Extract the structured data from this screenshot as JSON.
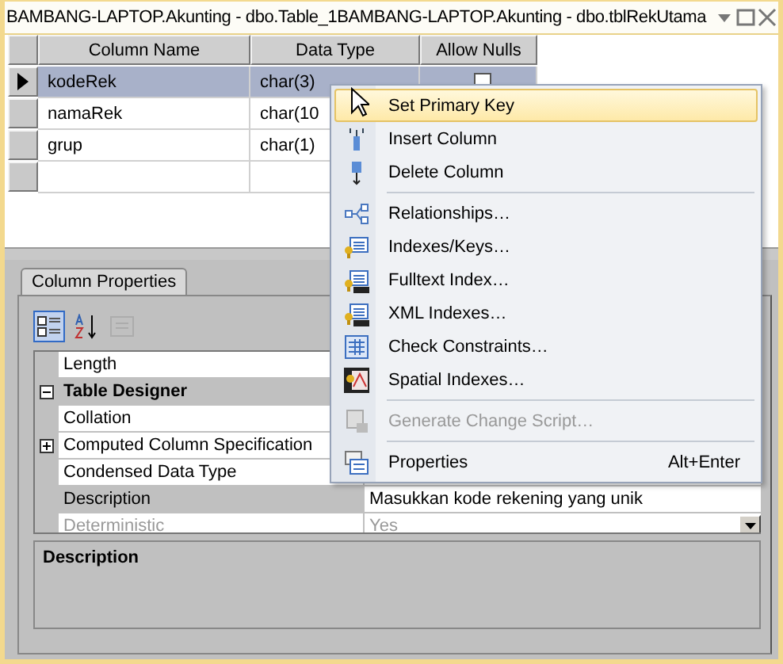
{
  "window": {
    "title": "BAMBANG-LAPTOP.Akunting - dbo.Table_1BAMBANG-LAPTOP.Akunting - dbo.tblRekUtama"
  },
  "grid": {
    "columns": [
      "Column Name",
      "Data Type",
      "Allow Nulls"
    ],
    "rows": [
      {
        "name": "kodeRek",
        "type": "char(3)",
        "allow_nulls": false,
        "selected": true
      },
      {
        "name": "namaRek",
        "type": "char(10",
        "selected": false
      },
      {
        "name": "grup",
        "type": "char(1)",
        "selected": false
      }
    ]
  },
  "properties": {
    "tab": {
      "label": "Column Properties",
      "selected": true
    },
    "toolbar": [
      {
        "selected": true,
        "disabled": false
      },
      {
        "selected": false,
        "disabled": false
      },
      {
        "selected": false,
        "disabled": true
      }
    ],
    "rows": [
      {
        "kind": "property",
        "label": "Length",
        "selected": false
      },
      {
        "kind": "category",
        "label": "Table Designer",
        "expanded": true
      },
      {
        "kind": "property",
        "label": "Collation",
        "selected": false
      },
      {
        "kind": "property",
        "label": "Computed Column Specification",
        "expanded": false,
        "selected": false
      },
      {
        "kind": "property",
        "label": "Condensed Data Type",
        "selected": false
      },
      {
        "kind": "property",
        "label": "Description",
        "value": "Masukkan kode rekening yang unik",
        "selected": true
      },
      {
        "kind": "property",
        "label": "Deterministic",
        "value": "Yes",
        "disabled": true,
        "selected": false
      }
    ],
    "description_title": "Description"
  },
  "context_menu": {
    "items": [
      {
        "kind": "key",
        "label": "Set Primary Key",
        "selected": true,
        "disabled": false
      },
      {
        "kind": "insert",
        "label": "Insert Column",
        "selected": false,
        "disabled": false
      },
      {
        "kind": "delete",
        "label": "Delete Column",
        "selected": false,
        "disabled": false
      },
      {
        "kind": "separator"
      },
      {
        "kind": "relationships",
        "label": "Relationships…",
        "selected": false,
        "disabled": false
      },
      {
        "kind": "indexes",
        "label": "Indexes/Keys…",
        "selected": false,
        "disabled": false
      },
      {
        "kind": "fulltext",
        "label": "Fulltext Index…",
        "selected": false,
        "disabled": false
      },
      {
        "kind": "xml",
        "label": "XML Indexes…",
        "selected": false,
        "disabled": false
      },
      {
        "kind": "check",
        "label": "Check Constraints…",
        "selected": false,
        "disabled": false
      },
      {
        "kind": "spatial",
        "label": "Spatial Indexes…",
        "selected": false,
        "disabled": false
      },
      {
        "kind": "separator"
      },
      {
        "kind": "script",
        "label": "Generate Change Script…",
        "selected": false,
        "disabled": true
      },
      {
        "kind": "separator"
      },
      {
        "kind": "properties",
        "label": "Properties",
        "shortcut": "Alt+Enter",
        "selected": false,
        "disabled": false
      }
    ]
  }
}
